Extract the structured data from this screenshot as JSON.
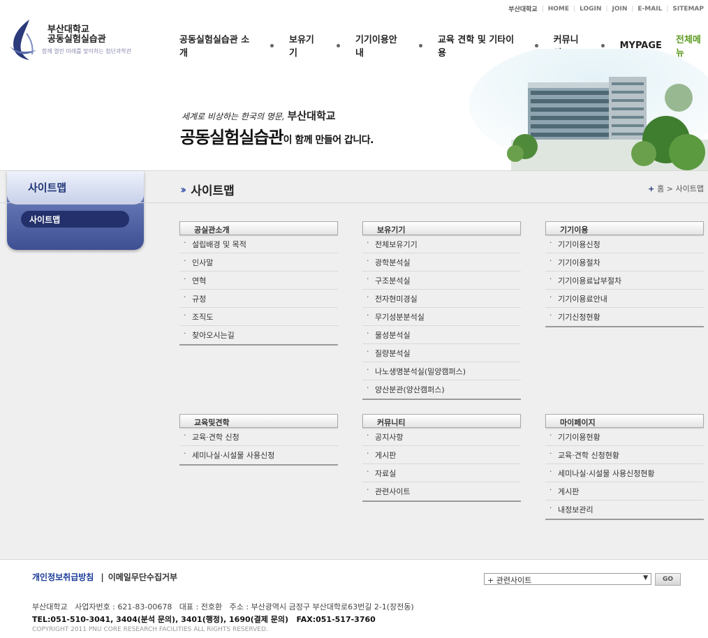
{
  "util_nav": {
    "university": "부산대학교",
    "items": [
      "HOME",
      "LOGIN",
      "JOIN",
      "E-MAIL",
      "SITEMAP"
    ]
  },
  "logo": {
    "line1": "부산대학교",
    "line2": "공동실험실습관",
    "tagline": "함께 열린 미래를 맞이하는 첨단과학관"
  },
  "gnb": {
    "items": [
      "공동실험실습관 소개",
      "보유기기",
      "기기이용안내",
      "교육 견학 및 기타이용",
      "커뮤니티",
      "MYPAGE"
    ],
    "all_menu": "전체메뉴"
  },
  "visual": {
    "slogan_small": "세계로 비상하는 한국의 명문, ",
    "slogan_univ": "부산대학교",
    "slogan_main": "공동실험실습관",
    "slogan_tail": "이 함께 만들어 갑니다."
  },
  "lnb": {
    "title": "사이트맵",
    "item": "사이트맵"
  },
  "page": {
    "title": "사이트맵",
    "location_home": "홈",
    "location_sep": ">",
    "location_current": "사이트맵"
  },
  "sitemap": [
    {
      "title": "공실관소개",
      "items": [
        "설립배경 및 목적",
        "인사말",
        "연혁",
        "규정",
        "조직도",
        "찾아오시는길"
      ]
    },
    {
      "title": "보유기기",
      "items": [
        "전체보유기기",
        "광학분석실",
        "구조분석실",
        "전자현미경실",
        "무기성분분석실",
        "물성분석실",
        "질량분석실",
        "나노생명분석실(밀양캠퍼스)",
        "양산분관(양산캠퍼스)"
      ]
    },
    {
      "title": "기기이용",
      "items": [
        "기기이용신청",
        "기기이용절차",
        "기기이용료납부절차",
        "기기이용료안내",
        "기기신청현황"
      ]
    },
    {
      "title": "교육및견학",
      "items": [
        "교육·견학 신청",
        "세미나실·시설물 사용신청"
      ]
    },
    {
      "title": "커뮤니티",
      "items": [
        "공지사항",
        "게시판",
        "자료실",
        "관련사이트"
      ]
    },
    {
      "title": "마이페이지",
      "items": [
        "기기이용현황",
        "교육·견학 신청현황",
        "세미나실·시설물 사용신청현황",
        "게시판",
        "내정보관리"
      ]
    }
  ],
  "footer": {
    "privacy": "개인정보취급방침",
    "bar": "|",
    "email_refuse": "이메일무단수집거부",
    "related_select": "+ 관련사이트",
    "go": "GO",
    "address": "부산대학교   사업자번호 : 621-83-00678   대표 : 전호환   주소 : 부산광역시 금정구 부산대학로63번길 2-1(장전동)",
    "tel": "TEL:051-510-3041, 3404(분석 문의), 3401(행정), 1690(결제 문의)   FAX:051-517-3760",
    "copyright": "COPYRIGHT 2011 PNU CORE RESEARCH FACILITIES ALL RIGHTS RESERVED."
  },
  "colors": {
    "accent_green": "#5b9a1f",
    "lnb_navy": "#23306b",
    "link_blue": "#1a3a9a"
  }
}
